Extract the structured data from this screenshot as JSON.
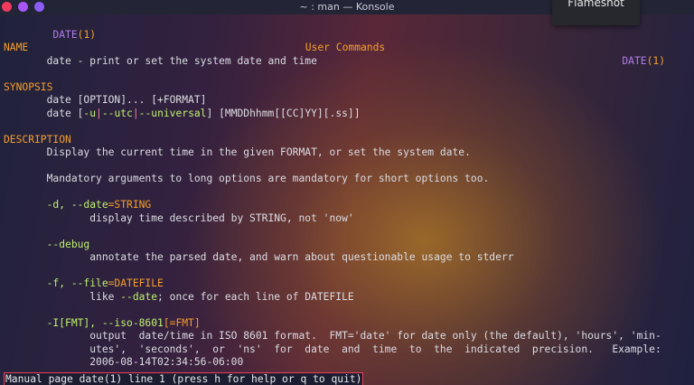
{
  "window": {
    "title": "~ : man — Konsole"
  },
  "overlay": {
    "label": "Flameshot"
  },
  "header": {
    "left_cmd": "DATE",
    "left_sec": "(1)",
    "center": "User Commands",
    "right_cmd": "DATE",
    "right_sec": "(1)"
  },
  "sections": {
    "name": "NAME",
    "synopsis": "SYNOPSIS",
    "description": "DESCRIPTION"
  },
  "content": {
    "name_desc": "date - print or set the system date and time",
    "syn1": "date [OPTION]... [+FORMAT]",
    "syn2_a": "date [",
    "syn2_u": "-u",
    "syn2_p1": "|",
    "syn2_utc": "--utc",
    "syn2_p2": "|",
    "syn2_univ": "--universal",
    "syn2_b": "] [MMDDhhmm[[CC]YY][.ss]]",
    "desc1": "Display the current time in the given FORMAT, or set the system date.",
    "desc2": "Mandatory arguments to long options are mandatory for short options too.",
    "opt_d_a": "-d, --date",
    "opt_d_b": "=STRING",
    "opt_d_desc": "display time described by STRING, not 'now'",
    "opt_debug": "--debug",
    "opt_debug_desc": "annotate the parsed date, and warn about questionable usage to stderr",
    "opt_f_a": "-f, --file",
    "opt_f_b": "=DATEFILE",
    "opt_f_desc_a": "like ",
    "opt_f_desc_b": "--date",
    "opt_f_desc_c": "; once for each line of DATEFILE",
    "opt_i_a": "-I[FMT], --iso-8601",
    "opt_i_b": "[=FMT]",
    "opt_i_desc1": "output  date/time in ISO 8601 format.  FMT='date' for date only (the default), 'hours', 'min-",
    "opt_i_desc2": "utes',  'seconds',  or  'ns'  for  date  and  time  to  the  indicated  precision.   Example:",
    "opt_i_desc3": "2006-08-14T02:34:56-06:00"
  },
  "status": {
    "text": "Manual page date(1) line 1 (press h for help or q to quit)"
  }
}
